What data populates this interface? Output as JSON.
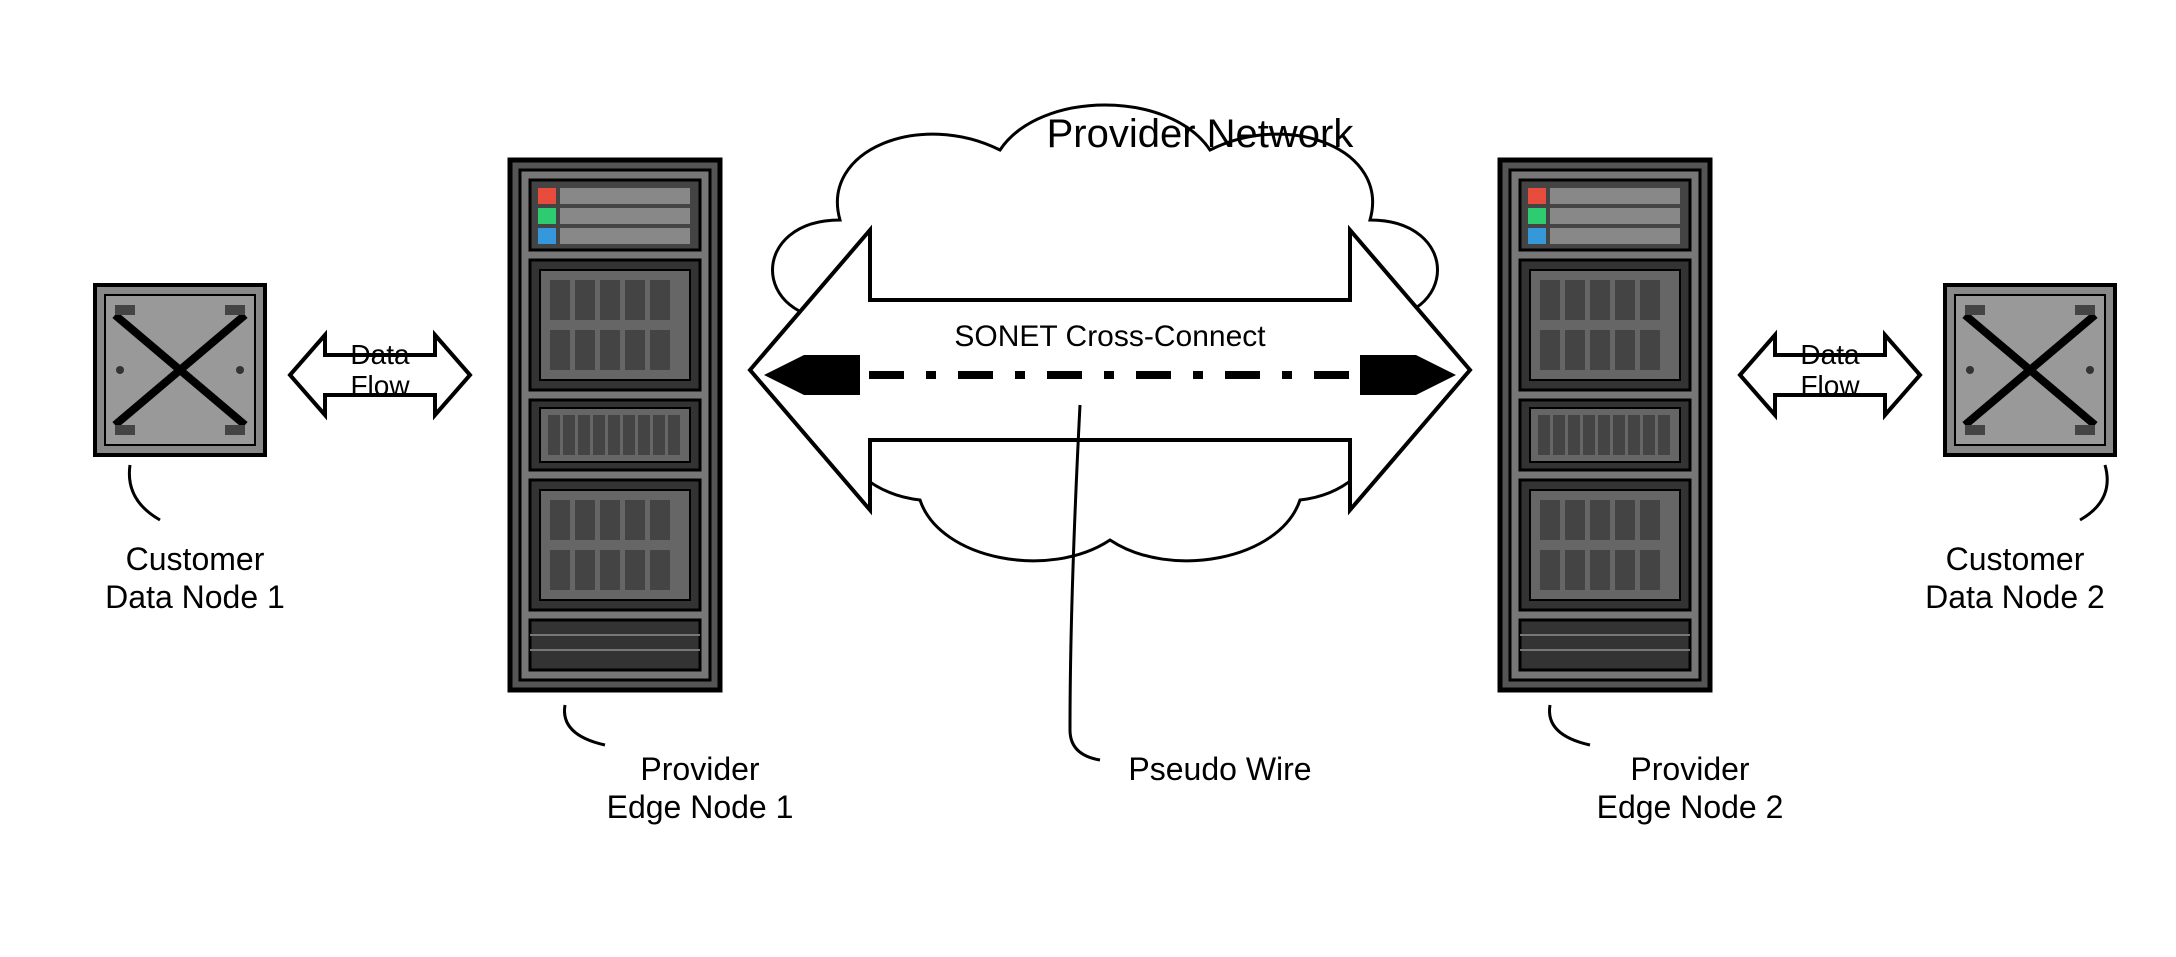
{
  "title": "Provider Network",
  "nodes": {
    "customer1": "Customer\nData Node 1",
    "customer2": "Customer\nData Node 2",
    "provider1": "Provider\nEdge Node 1",
    "provider2": "Provider\nEdge Node 2"
  },
  "connections": {
    "dataFlow1": "Data\nFlow",
    "dataFlow2": "Data\nFlow",
    "sonet": "SONET Cross-Connect",
    "pseudoWire": "Pseudo Wire"
  }
}
